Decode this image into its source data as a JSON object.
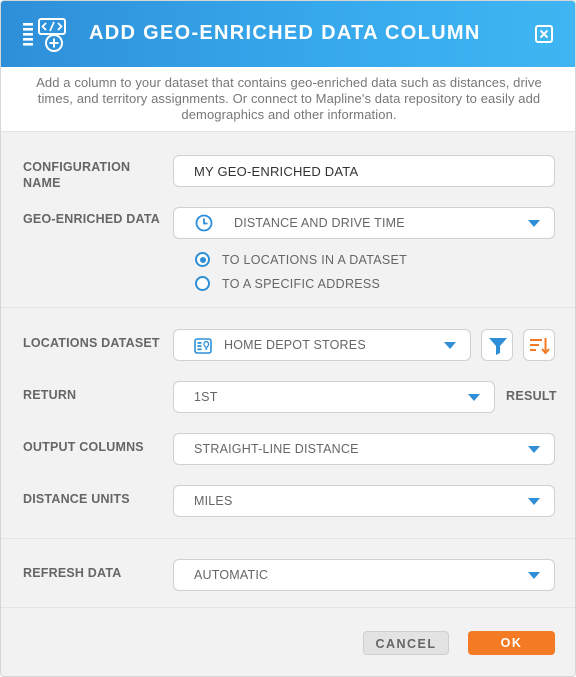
{
  "dialog": {
    "title": "ADD GEO-ENRICHED DATA COLUMN",
    "description": "Add a column to your dataset that contains geo-enriched data such as distances, drive times, and territory assignments. Or connect to Mapline's data repository to easily add demographics and other information."
  },
  "config": {
    "name_label": "CONFIGURATION NAME",
    "name_value": "MY GEO-ENRICHED DATA"
  },
  "geo": {
    "label": "GEO-ENRICHED DATA",
    "value": "DISTANCE AND DRIVE TIME",
    "options": [
      {
        "label": "TO LOCATIONS IN A DATASET",
        "checked": true
      },
      {
        "label": "TO A SPECIFIC ADDRESS",
        "checked": false
      }
    ]
  },
  "locations": {
    "label": "LOCATIONS DATASET",
    "value": "HOME DEPOT STORES"
  },
  "return": {
    "label": "RETURN",
    "value": "1ST",
    "suffix": "RESULT"
  },
  "output": {
    "label": "OUTPUT COLUMNS",
    "value": "STRAIGHT-LINE DISTANCE"
  },
  "units": {
    "label": "DISTANCE UNITS",
    "value": "MILES"
  },
  "refresh": {
    "label": "REFRESH DATA",
    "value": "AUTOMATIC"
  },
  "buttons": {
    "cancel": "CANCEL",
    "ok": "OK"
  },
  "colors": {
    "accent": "#2e8fd8",
    "ok": "#f47a24",
    "sort_icon": "#f47a24"
  },
  "icons": {
    "header": "add-data-column-icon",
    "close": "close-icon",
    "geo": "clock-icon",
    "dataset": "dataset-icon",
    "filter": "filter-icon",
    "sort": "sort-icon",
    "caret": "chevron-down-icon"
  }
}
